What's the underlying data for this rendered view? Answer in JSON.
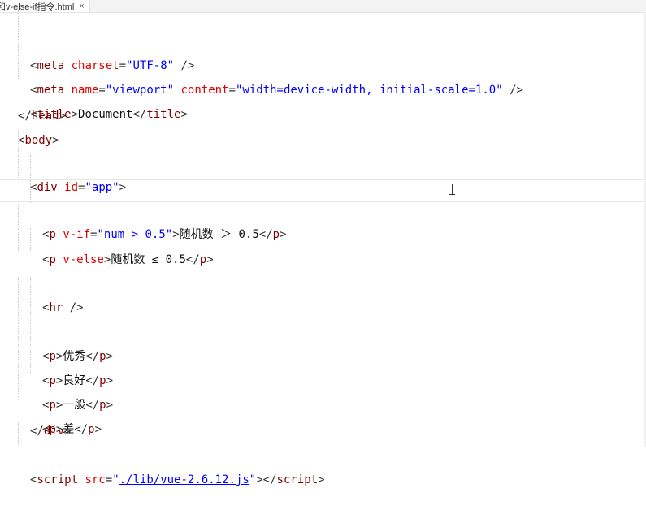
{
  "tab": {
    "title": "和v-else-if指令.html",
    "close_glyph": "×"
  },
  "colors": {
    "tag": "#800000",
    "attribute": "#e50000",
    "value": "#0000ff",
    "text": "#111111"
  },
  "icons": {
    "text_cursor": "i-beam-cursor-icon"
  },
  "code": {
    "l1": {
      "open": "<",
      "tag": "meta",
      "attr1": "charset",
      "eq1": "=",
      "val1": "\"UTF-8\"",
      "close": " />"
    },
    "l2": {
      "open": "<",
      "tag": "meta",
      "attr1": "name",
      "eq1": "=",
      "val1": "\"viewport\"",
      "attr2": "content",
      "eq2": "=",
      "val2": "\"width=device-width, initial-scale=1.0\"",
      "close": " />"
    },
    "l3": {
      "open": "<",
      "tag": "title",
      "gt": ">",
      "text": "Document",
      "end_open": "</",
      "end_tag": "title",
      "end_close": ">"
    },
    "l4": {
      "end_open": "</",
      "tag": "head",
      "end_close": ">"
    },
    "l5": {
      "open": "<",
      "tag": "body",
      "gt": ">"
    },
    "l6": {
      "open": "<",
      "tag": "div",
      "attr1": "id",
      "eq1": "=",
      "val1": "\"app\"",
      "gt": ">"
    },
    "l7": {
      "open": "<",
      "tag": "p",
      "attr1": "v-if",
      "eq1": "=",
      "val1": "\"num > 0.5\"",
      "gt": ">",
      "text": "随机数 ＞ 0.5",
      "end_open": "</",
      "end_tag": "p",
      "end_close": ">"
    },
    "l8": {
      "open": "<",
      "tag": "p",
      "attr1": "v-else",
      "gt": ">",
      "text": "随机数 ≤ 0.5",
      "end_open": "</",
      "end_tag": "p",
      "end_close": ">"
    },
    "l10": {
      "open": "<",
      "tag": "hr",
      "close": " />"
    },
    "l12": {
      "open": "<",
      "tag": "p",
      "gt": ">",
      "text": "优秀",
      "end_open": "</",
      "end_tag": "p",
      "end_close": ">"
    },
    "l13": {
      "open": "<",
      "tag": "p",
      "gt": ">",
      "text": "良好",
      "end_open": "</",
      "end_tag": "p",
      "end_close": ">"
    },
    "l14": {
      "open": "<",
      "tag": "p",
      "gt": ">",
      "text": "一般",
      "end_open": "</",
      "end_tag": "p",
      "end_close": ">"
    },
    "l15": {
      "open": "<",
      "tag": "p",
      "gt": ">",
      "text": "差",
      "end_open": "</",
      "end_tag": "p",
      "end_close": ">"
    },
    "l16": {
      "end_open": "</",
      "tag": "div",
      "end_close": ">"
    },
    "l18": {
      "open": "<",
      "tag": "script",
      "attr1": "src",
      "eq1": "=",
      "q1": "\"",
      "link": "./lib/vue-2.6.12.js",
      "q2": "\"",
      "gt": ">",
      "end_open": "</",
      "end_tag": "script",
      "end_close": ">"
    }
  }
}
